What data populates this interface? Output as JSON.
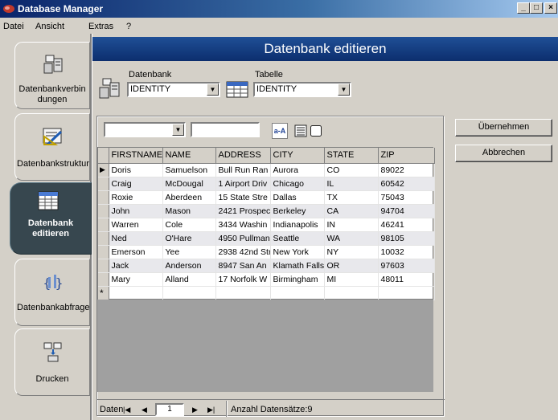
{
  "window": {
    "title": "Database Manager",
    "min": "_",
    "max": "□",
    "close": "×"
  },
  "menu": [
    "Datei",
    "Ansicht",
    "Extras",
    "?"
  ],
  "sidebar": {
    "items": [
      {
        "label": "Datenbankverbindungen",
        "active": false
      },
      {
        "label": "Datenbankstruktur",
        "active": false
      },
      {
        "label": "Datenbank editieren",
        "active": true
      },
      {
        "label": "Datenbankabfrage",
        "active": false
      },
      {
        "label": "Drucken",
        "active": false
      }
    ]
  },
  "header": {
    "title": "Datenbank editieren"
  },
  "selectors": {
    "database_label": "Datenbank",
    "database_value": "IDENTITY",
    "table_label": "Tabelle",
    "table_value": "IDENTITY"
  },
  "filter": {
    "field_value": "",
    "search_value": "",
    "sort_label": "a-A"
  },
  "grid": {
    "columns": [
      "FIRSTNAME",
      "NAME",
      "ADDRESS",
      "CITY",
      "STATE",
      "ZIP"
    ],
    "rows": [
      [
        "Doris",
        "Samuelson",
        "Bull Run Ran",
        "Aurora",
        "CO",
        "89022"
      ],
      [
        "Craig",
        "McDougal",
        "1 Airport Driv",
        "Chicago",
        "IL",
        "60542"
      ],
      [
        "Roxie",
        "Aberdeen",
        "15 State Stre",
        "Dallas",
        "TX",
        "75043"
      ],
      [
        "John",
        "Mason",
        "2421 Prospec",
        "Berkeley",
        "CA",
        "94704"
      ],
      [
        "Warren",
        "Cole",
        "3434 Washin",
        "Indianapolis",
        "IN",
        "46241"
      ],
      [
        "Ned",
        "O'Hare",
        "4950 Pullman",
        "Seattle",
        "WA",
        "98105"
      ],
      [
        "Emerson",
        "Yee",
        "2938 42nd Str",
        "New York",
        "NY",
        "10032"
      ],
      [
        "Jack",
        "Anderson",
        "8947 San An",
        "Klamath Falls",
        "OR",
        "97603"
      ],
      [
        "Mary",
        "Alland",
        "17 Norfolk W",
        "Birmingham",
        "MI",
        "48011"
      ]
    ],
    "current_row_marker": "▶",
    "new_row_marker": "*"
  },
  "navigator": {
    "label": "Daten",
    "first": "|◀",
    "prev": "◀",
    "record": "1",
    "next": "▶",
    "last": "▶|",
    "count_text": "Anzahl Datensätze:9"
  },
  "actions": {
    "apply": "Übernehmen",
    "cancel": "Abbrechen"
  },
  "colors": {
    "header": "#0c2e6e",
    "active_nav": "#37474f",
    "face": "#d4d0c8"
  }
}
